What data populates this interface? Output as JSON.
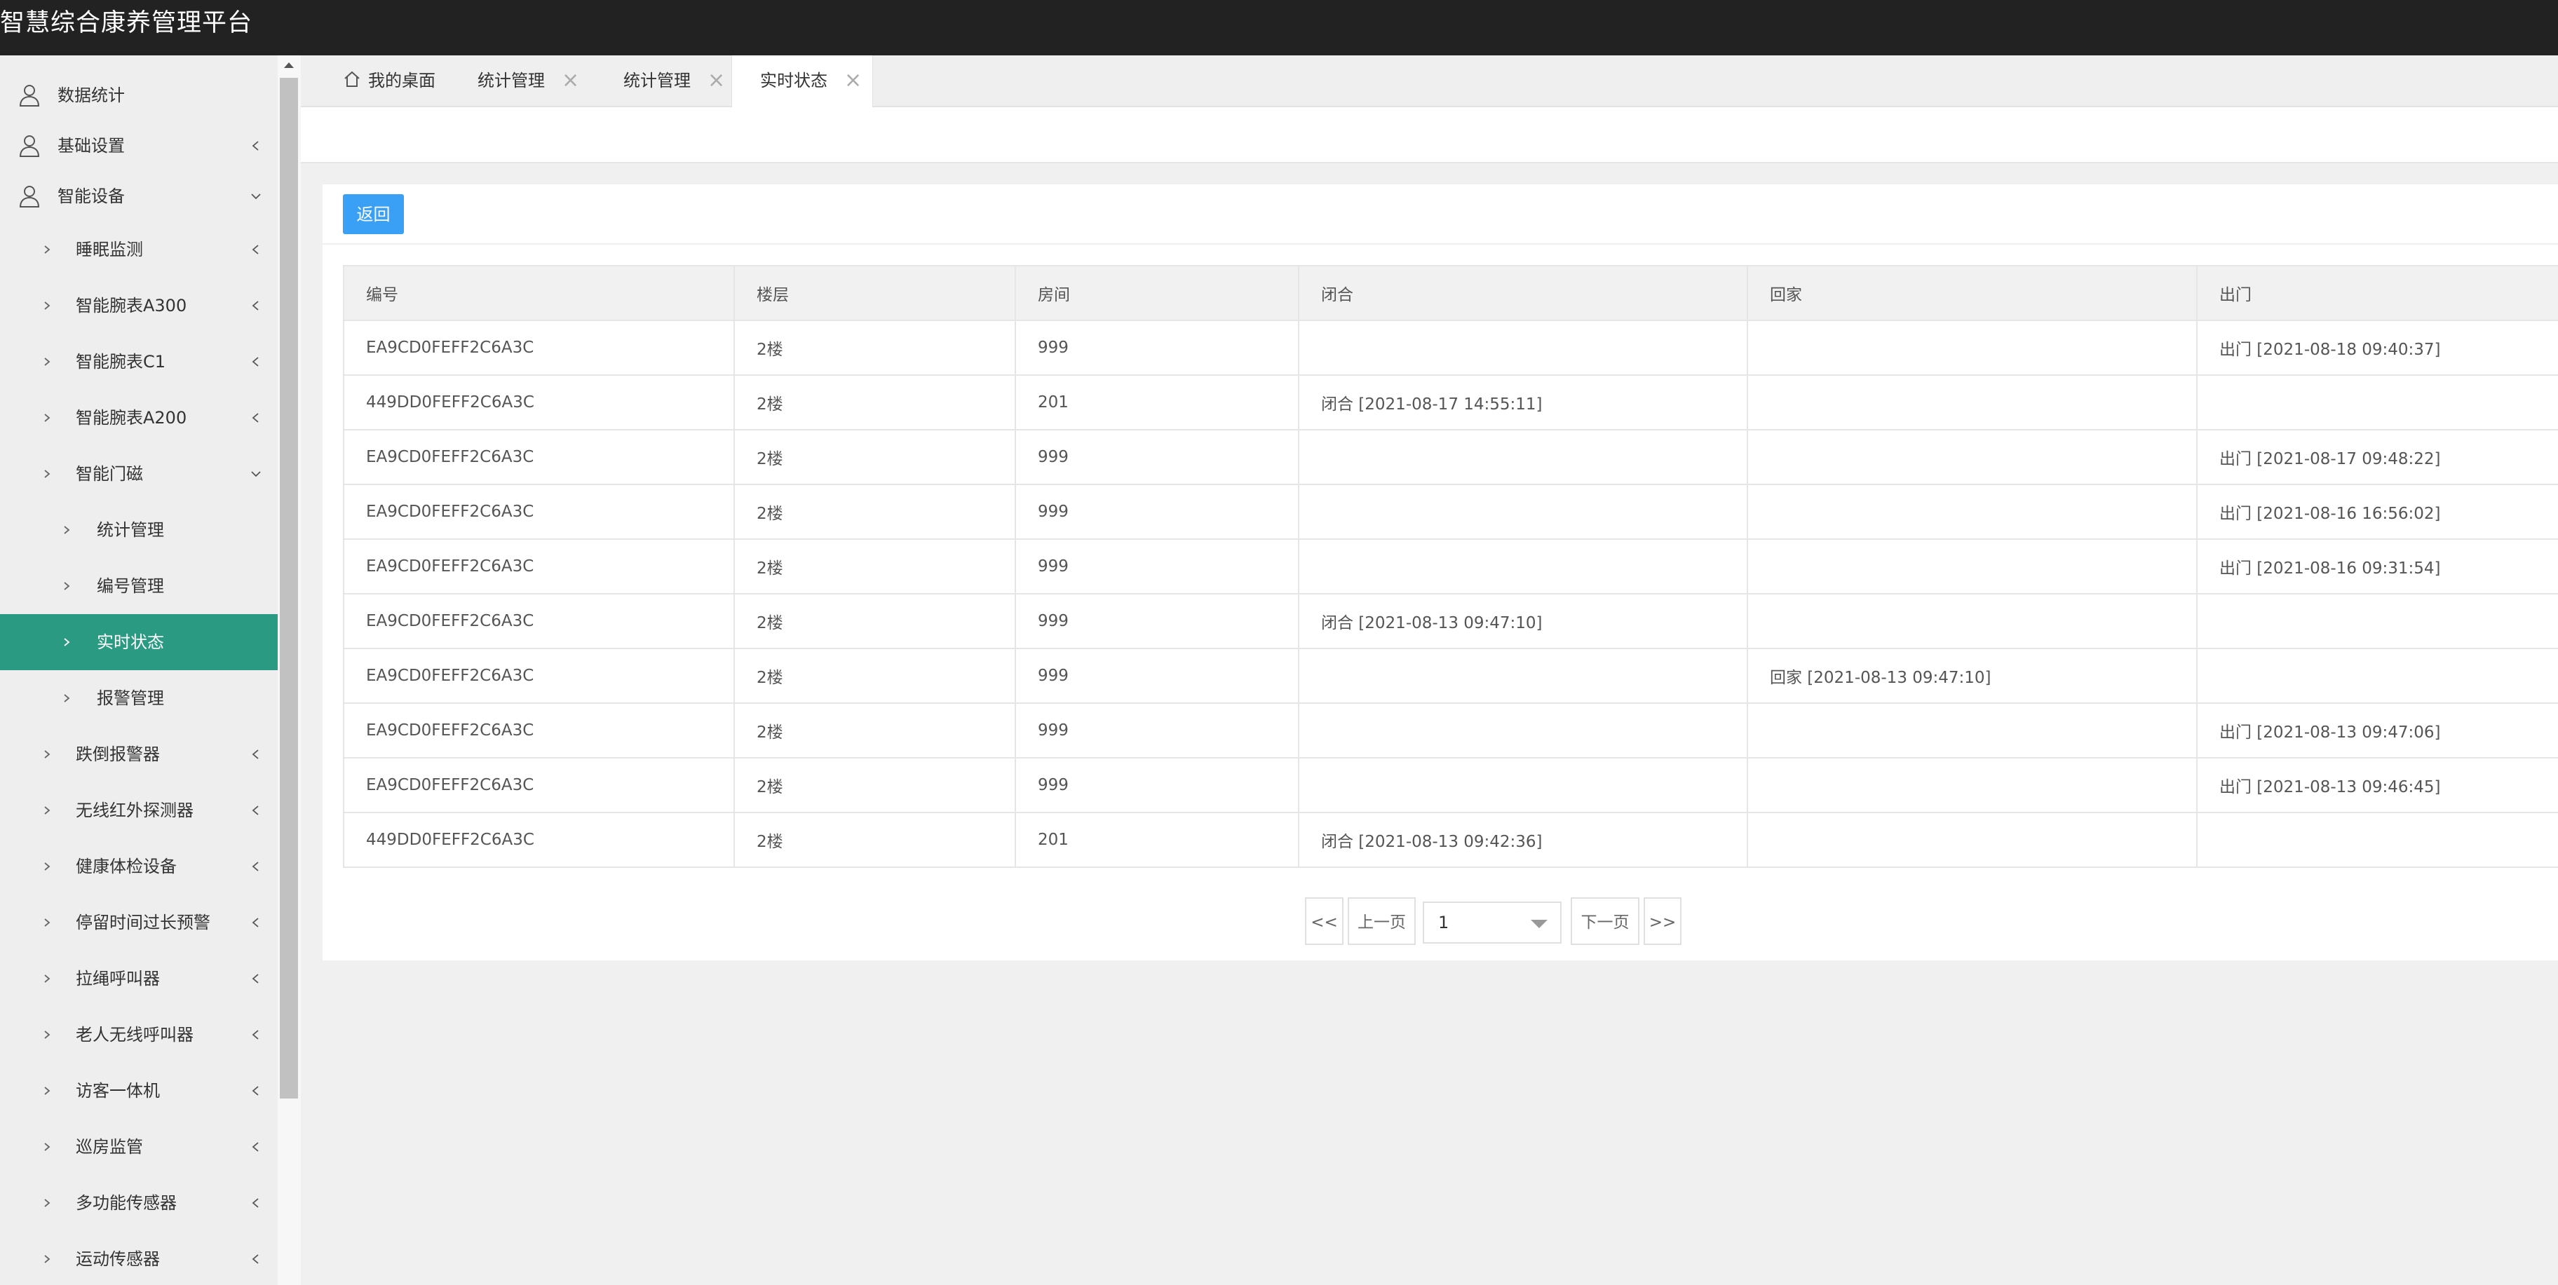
{
  "app": {
    "title": "智慧综合康养管理平台"
  },
  "sidebar": {
    "items": [
      {
        "label": "数据统计",
        "level": 0,
        "icon": "user-icon",
        "arrow": "none"
      },
      {
        "label": "基础设置",
        "level": 0,
        "icon": "user-icon",
        "arrow": "left"
      },
      {
        "label": "智能设备",
        "level": 0,
        "icon": "user-icon",
        "arrow": "down"
      },
      {
        "label": "睡眠监测",
        "level": 1,
        "arrow": "left"
      },
      {
        "label": "智能腕表A300",
        "level": 1,
        "arrow": "left"
      },
      {
        "label": "智能腕表C1",
        "level": 1,
        "arrow": "left"
      },
      {
        "label": "智能腕表A200",
        "level": 1,
        "arrow": "left"
      },
      {
        "label": "智能门磁",
        "level": 1,
        "arrow": "down"
      },
      {
        "label": "统计管理",
        "level": 2,
        "arrow": "none"
      },
      {
        "label": "编号管理",
        "level": 2,
        "arrow": "none"
      },
      {
        "label": "实时状态",
        "level": 2,
        "arrow": "none",
        "active": true
      },
      {
        "label": "报警管理",
        "level": 2,
        "arrow": "none"
      },
      {
        "label": "跌倒报警器",
        "level": 1,
        "arrow": "left"
      },
      {
        "label": "无线红外探测器",
        "level": 1,
        "arrow": "left"
      },
      {
        "label": "健康体检设备",
        "level": 1,
        "arrow": "left"
      },
      {
        "label": "停留时间过长预警",
        "level": 1,
        "arrow": "left"
      },
      {
        "label": "拉绳呼叫器",
        "level": 1,
        "arrow": "left"
      },
      {
        "label": "老人无线呼叫器",
        "level": 1,
        "arrow": "left"
      },
      {
        "label": "访客一体机",
        "level": 1,
        "arrow": "left"
      },
      {
        "label": "巡房监管",
        "level": 1,
        "arrow": "left"
      },
      {
        "label": "多功能传感器",
        "level": 1,
        "arrow": "left"
      },
      {
        "label": "运动传感器",
        "level": 1,
        "arrow": "left"
      }
    ]
  },
  "tabs": [
    {
      "label": "我的桌面",
      "icon": "home-icon",
      "closable": false
    },
    {
      "label": "统计管理",
      "closable": true
    },
    {
      "label": "统计管理",
      "closable": true
    },
    {
      "label": "实时状态",
      "closable": true,
      "active": true
    }
  ],
  "toolbar": {
    "back_label": "返回"
  },
  "table": {
    "columns": [
      "编号",
      "楼层",
      "房间",
      "闭合",
      "回家",
      "出门"
    ],
    "rows": [
      [
        "EA9CD0FEFF2C6A3C",
        "2楼",
        "999",
        "",
        "",
        "出门 [2021-08-18 09:40:37]"
      ],
      [
        "449DD0FEFF2C6A3C",
        "2楼",
        "201",
        "闭合 [2021-08-17 14:55:11]",
        "",
        ""
      ],
      [
        "EA9CD0FEFF2C6A3C",
        "2楼",
        "999",
        "",
        "",
        "出门 [2021-08-17 09:48:22]"
      ],
      [
        "EA9CD0FEFF2C6A3C",
        "2楼",
        "999",
        "",
        "",
        "出门 [2021-08-16 16:56:02]"
      ],
      [
        "EA9CD0FEFF2C6A3C",
        "2楼",
        "999",
        "",
        "",
        "出门 [2021-08-16 09:31:54]"
      ],
      [
        "EA9CD0FEFF2C6A3C",
        "2楼",
        "999",
        "闭合 [2021-08-13 09:47:10]",
        "",
        ""
      ],
      [
        "EA9CD0FEFF2C6A3C",
        "2楼",
        "999",
        "",
        "回家 [2021-08-13 09:47:10]",
        ""
      ],
      [
        "EA9CD0FEFF2C6A3C",
        "2楼",
        "999",
        "",
        "",
        "出门 [2021-08-13 09:47:06]"
      ],
      [
        "EA9CD0FEFF2C6A3C",
        "2楼",
        "999",
        "",
        "",
        "出门 [2021-08-13 09:46:45]"
      ],
      [
        "449DD0FEFF2C6A3C",
        "2楼",
        "201",
        "闭合 [2021-08-13 09:42:36]",
        "",
        ""
      ]
    ]
  },
  "pager": {
    "first": "<<",
    "prev": "上一页",
    "page": "1",
    "next": "下一页",
    "last": ">>"
  },
  "colors": {
    "header": "#222222",
    "active_menu": "#2b9a82",
    "back_button": "#3aa0f5"
  }
}
